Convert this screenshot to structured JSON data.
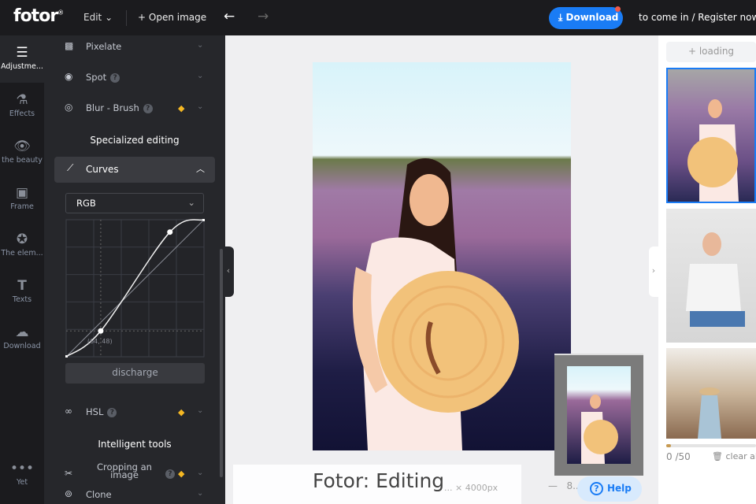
{
  "topbar": {
    "logo": "fotor",
    "logo_mark": "®",
    "edit": "Edit",
    "open_image": "Open image",
    "download": "Download",
    "register": "to come in / Register now"
  },
  "rail": [
    {
      "label": "Adjustme...",
      "icon": "sliders-icon"
    },
    {
      "label": "Effects",
      "icon": "flask-icon"
    },
    {
      "label": "the beauty",
      "icon": "eye-icon"
    },
    {
      "label": "Frame",
      "icon": "frame-icon"
    },
    {
      "label": "The elem...",
      "icon": "star-icon"
    },
    {
      "label": "Texts",
      "icon": "text-icon"
    },
    {
      "label": "Download",
      "icon": "cloud-upload-icon"
    },
    {
      "label": "Yet",
      "icon": "more-icon"
    }
  ],
  "panel": {
    "pixelate": "Pixelate",
    "spot": "Spot",
    "blur_brush": "Blur - Brush",
    "specialized": "Specialized editing",
    "curves": "Curves",
    "channel": "RGB",
    "point_label": "(64, 48)",
    "discharge": "discharge",
    "hsl": "HSL",
    "intelligent": "Intelligent tools",
    "cropping": "Cropping an image",
    "clone": "Clone"
  },
  "curve_points": [
    [
      0,
      0
    ],
    [
      64,
      48
    ],
    [
      192,
      232
    ],
    [
      255,
      255
    ]
  ],
  "canvas": {
    "dims": "... × 4000px",
    "zoom": "8..."
  },
  "overlay_title": "Fotor: Editing",
  "help": "Help",
  "right": {
    "loading": "loading",
    "count": "0",
    "total": "/50",
    "clear_all": "clear all",
    "progress_fraction": 0.05
  },
  "colors": {
    "accent": "#1a7cf5",
    "premium": "#f5b823",
    "dark": "#1b1b1e",
    "panel": "#26272b"
  }
}
